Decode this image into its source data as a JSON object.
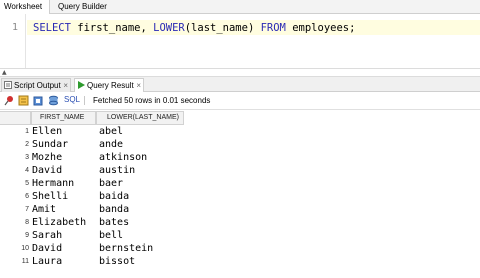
{
  "top_tabs": {
    "worksheet": "Worksheet",
    "query_builder": "Query Builder"
  },
  "editor": {
    "line_number": "1",
    "sql": {
      "kw_select": "SELECT",
      "col1": " first_name, ",
      "fn_lower": "LOWER",
      "arg": "(last_name) ",
      "kw_from": "FROM",
      "table": " employees;"
    }
  },
  "bottom_tabs": {
    "script_output": "Script Output",
    "query_result": "Query Result"
  },
  "toolbar": {
    "sql_label": "SQL",
    "status": "Fetched 50 rows in 0.01 seconds"
  },
  "grid": {
    "headers": {
      "col1": "FIRST_NAME",
      "col2": "LOWER(LAST_NAME)"
    },
    "rows": [
      {
        "n": "1",
        "first": "Ellen",
        "last": "abel"
      },
      {
        "n": "2",
        "first": "Sundar",
        "last": "ande"
      },
      {
        "n": "3",
        "first": "Mozhe",
        "last": "atkinson"
      },
      {
        "n": "4",
        "first": "David",
        "last": "austin"
      },
      {
        "n": "5",
        "first": "Hermann",
        "last": "baer"
      },
      {
        "n": "6",
        "first": "Shelli",
        "last": "baida"
      },
      {
        "n": "7",
        "first": "Amit",
        "last": "banda"
      },
      {
        "n": "8",
        "first": "Elizabeth",
        "last": "bates"
      },
      {
        "n": "9",
        "first": "Sarah",
        "last": "bell"
      },
      {
        "n": "10",
        "first": "David",
        "last": "bernstein"
      },
      {
        "n": "11",
        "first": "Laura",
        "last": "bissot"
      }
    ]
  },
  "colors": {
    "keyword": "#2a2ab4",
    "line_highlight": "#fffde0",
    "sql_link": "#2b4fb3"
  }
}
